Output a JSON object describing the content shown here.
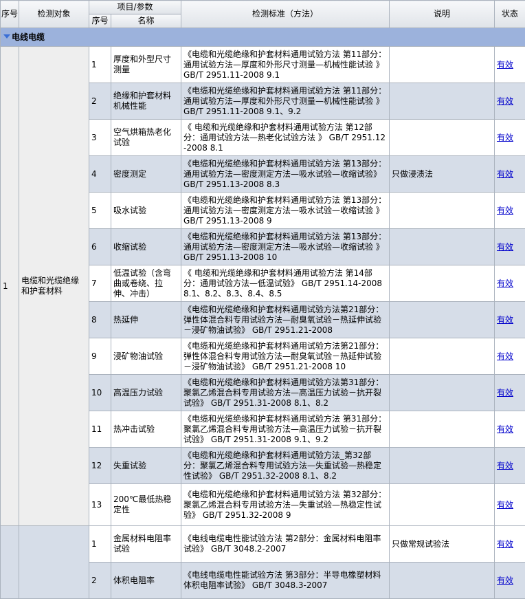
{
  "header": {
    "col_seq": "序号",
    "col_object": "检测对象",
    "col_item_group": "项目/参数",
    "col_item_seq": "序号",
    "col_item_name": "名称",
    "col_standard": "检测标准（方法）",
    "col_note": "说明",
    "col_status": "状态"
  },
  "category": {
    "label": "电线电缆"
  },
  "groups": [
    {
      "seq": "1",
      "object": "电缆和光缆绝缘和护套材料",
      "items": [
        {
          "seq": "1",
          "name": "厚度和外型尺寸测量",
          "standard": "《电缆和光缆绝缘和护套材料通用试验方法 第11部分：通用试验方法—厚度和外形尺寸测量—机械性能试验 》 GB/T 2951.11-2008 9.1",
          "note": "",
          "status": "有效"
        },
        {
          "seq": "2",
          "name": "绝缘和护套材料机械性能",
          "standard": "《电缆和光缆绝缘和护套材料通用试验方法 第11部分：通用试验方法—厚度和外形尺寸测量—机械性能试验 》 GB/T 2951.11-2008 9.1、9.2",
          "note": "",
          "status": "有效"
        },
        {
          "seq": "3",
          "name": "空气烘箱热老化试验",
          "standard": "《 电缆和光缆绝缘和护套材料通用试验方法 第12部分：通用试验方法—热老化试验方法 》 GB/T 2951.12-2008 8.1",
          "note": "",
          "status": "有效"
        },
        {
          "seq": "4",
          "name": "密度测定",
          "standard": "《电缆和光缆绝缘和护套材料通用试验方法 第13部分：通用试验方法—密度测定方法—吸水试验—收缩试验》 GB/T 2951.13-2008 8.3",
          "note": "只做浸渍法",
          "status": "有效"
        },
        {
          "seq": "5",
          "name": "吸水试验",
          "standard": "《电缆和光缆绝缘和护套材料通用试验方法 第13部分：通用试验方法—密度测定方法—吸水试验—收缩试验 》 GB/T 2951.13-2008 9",
          "note": "",
          "status": "有效"
        },
        {
          "seq": "6",
          "name": "收缩试验",
          "standard": "《电缆和光缆绝缘和护套材料通用试验方法 第13部分：通用试验方法—密度测定方法—吸水试验—收缩试验 》 GB/T 2951.13-2008 10",
          "note": "",
          "status": "有效"
        },
        {
          "seq": "7",
          "name": "低温试验（含弯曲或卷绕、拉伸、冲击）",
          "standard": "《 电缆和光缆绝缘和护套材料通用试验方法 第14部分：通用试验方法—低温试验》 GB/T 2951.14-2008 8.1、8.2、8.3、8.4、8.5",
          "note": "",
          "status": "有效"
        },
        {
          "seq": "8",
          "name": "热延伸",
          "standard": "《电缆和光缆绝缘和护套材料通用试验方法第21部分：弹性体混合料专用试验方法—耐臭氧试验－热延伸试验－浸矿物油试验》 GB/T 2951.21-2008",
          "note": "",
          "status": "有效"
        },
        {
          "seq": "9",
          "name": "浸矿物油试验",
          "standard": "《电缆和光缆绝缘和护套材料通用试验方法第21部分：弹性体混合料专用试验方法—耐臭氧试验－热延伸试验－浸矿物油试验》 GB/T 2951.21-2008 10",
          "note": "",
          "status": "有效"
        },
        {
          "seq": "10",
          "name": "高温压力试验",
          "standard": "《电缆和光缆绝缘和护套材料通用试验方法第31部分：聚氯乙烯混合料专用试验方法—高温压力试验－抗开裂试验》 GB/T 2951.31-2008 8.1、8.2",
          "note": "",
          "status": "有效"
        },
        {
          "seq": "11",
          "name": "热冲击试验",
          "standard": "《电缆和光缆绝缘和护套材料通用试验方法 第31部分：聚氯乙烯混合料专用试验方法—高温压力试验－抗开裂试验》 GB/T 2951.31-2008 9.1、9.2",
          "note": "",
          "status": "有效"
        },
        {
          "seq": "12",
          "name": "失重试验",
          "standard": "《电缆和光缆绝缘和护套材料通用试验方法_第32部分：聚氯乙烯混合料专用试验方法—失重试验—热稳定性试验》 GB/T 2951.32-2008 8.1、8.2",
          "note": "",
          "status": "有效"
        },
        {
          "seq": "13",
          "name": "200℃最低热稳定性",
          "standard": "《电缆和光缆绝缘和护套材料通用试验方法 第32部分：聚氯乙烯混合料专用试验方法—失重试验—热稳定性试验》 GB/T 2951.32-2008 9",
          "note": "",
          "status": "有效"
        }
      ]
    },
    {
      "seq": "",
      "object": "",
      "items": [
        {
          "seq": "1",
          "name": "金属材料电阻率试验",
          "standard": "《电线电缆电性能试验方法 第2部分：金属材料电阻率试验》 GB/T 3048.2-2007",
          "note": "只做常规试验法",
          "status": "有效"
        },
        {
          "seq": "2",
          "name": "体积电阻率",
          "standard": "《电线电缆电性能试验方法 第3部分：半导电橡塑材料体积电阻率试验》 GB/T 3048.3-2007",
          "note": "",
          "status": "有效"
        }
      ]
    }
  ]
}
